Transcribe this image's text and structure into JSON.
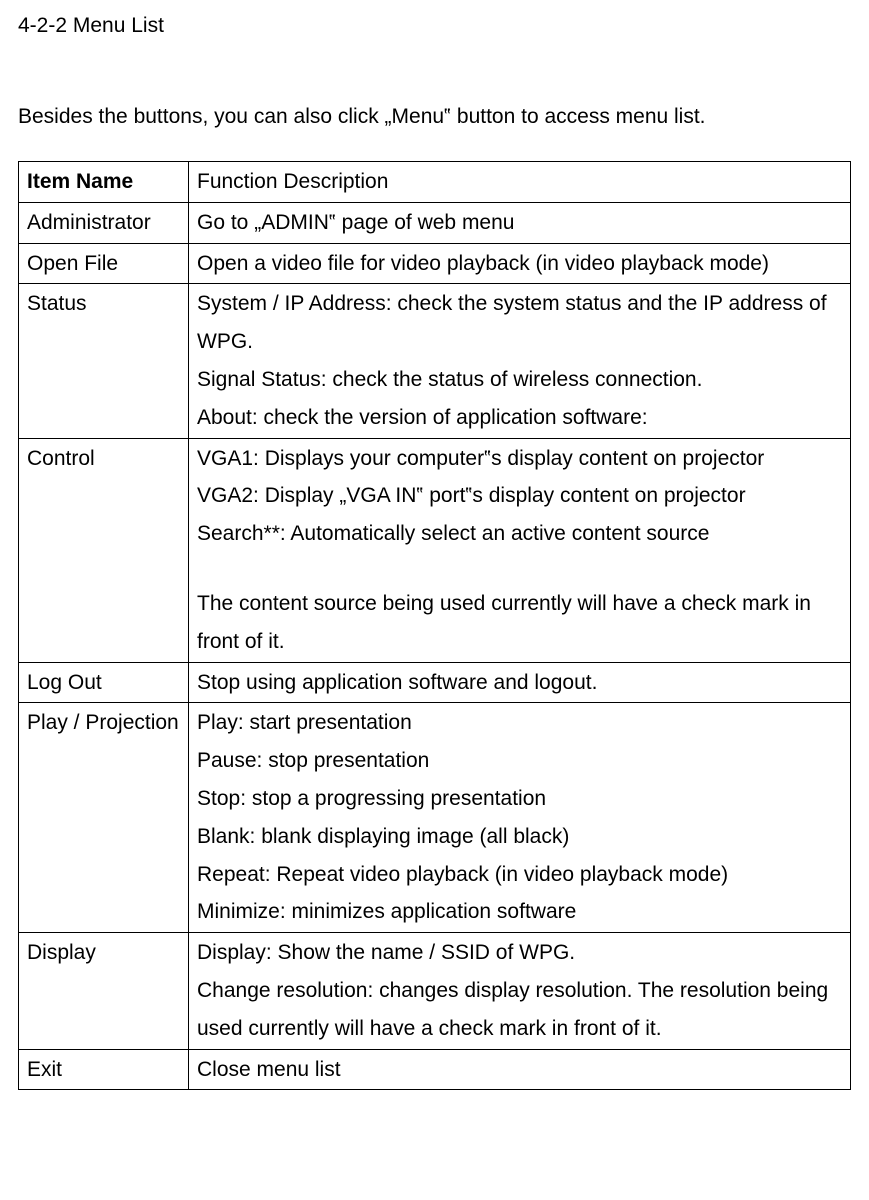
{
  "heading": "4-2-2 Menu List",
  "intro": "Besides the buttons, you can also click „Menu‟ button to access menu list.",
  "table": {
    "header": {
      "left": "Item Name",
      "right": "Function Description"
    },
    "rows": [
      {
        "item": "Administrator",
        "desc": "Go to „ADMIN‟ page of web menu"
      },
      {
        "item": "Open File",
        "desc": "Open a video file for video playback (in video playback mode)"
      },
      {
        "item": "Status",
        "desc_lines": [
          "System / IP Address: check the system status and the IP address of WPG.",
          "Signal Status: check the status of wireless connection.",
          "About: check the version of application software:"
        ]
      },
      {
        "item": "Control",
        "desc_lines": [
          "VGA1: Displays your computer‟s display content on projector",
          "VGA2: Display „VGA IN‟ port‟s display content on projector",
          "Search**: Automatically select an active content source",
          "",
          "The content source being used currently will have a check mark in front of it."
        ]
      },
      {
        "item": "Log Out",
        "desc": "Stop using application software and logout."
      },
      {
        "item": "Play / Projection",
        "desc_lines": [
          "Play: start presentation",
          "Pause: stop presentation",
          "Stop: stop a progressing presentation",
          "Blank: blank displaying image (all black)",
          "Repeat: Repeat video playback (in video playback mode)",
          "Minimize: minimizes application software"
        ]
      },
      {
        "item": "Display",
        "desc_lines": [
          "Display: Show the name / SSID of WPG.",
          "Change resolution: changes display resolution. The resolution being used currently will have a check mark in front of it."
        ]
      },
      {
        "item": "Exit",
        "desc": "Close menu list"
      }
    ]
  }
}
